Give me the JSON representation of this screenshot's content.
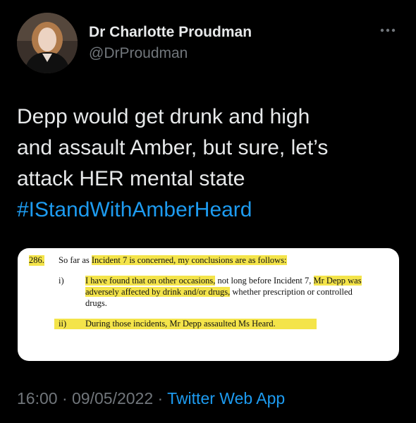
{
  "author": {
    "name": "Dr Charlotte Proudman",
    "handle": "@DrProudman"
  },
  "tweet": {
    "line1": "Depp would get drunk and high",
    "line2": "and assault Amber, but sure, let’s",
    "line3": "attack HER mental state",
    "hashtag": "#IStandWithAmberHeard"
  },
  "document": {
    "para_number": "286.",
    "intro_prefix": "So far as ",
    "intro_highlight": "Incident 7 is concerned, my conclusions are as follows:",
    "item1_label": "i)",
    "item1_l1_a": "I have found that on other occasions,",
    "item1_l1_b": " not long before Incident 7, ",
    "item1_l1_c": "Mr Depp was",
    "item1_l2_a": "adversely affected by drink and/or drugs,",
    "item1_l2_b": " whether prescription or controlled",
    "item1_l3": "drugs.",
    "item2_label": "ii)",
    "item2_text": "During those incidents, Mr Depp assaulted Ms Heard."
  },
  "footer": {
    "time": "16:00",
    "separator": " · ",
    "date": "09/05/2022",
    "separator2": " · ",
    "source": "Twitter Web App"
  },
  "icons": {
    "more": "more-horizontal-icon"
  },
  "colors": {
    "background": "#000000",
    "text": "#e7e9ea",
    "secondary": "#71767b",
    "link": "#1d9bf0",
    "highlight": "#f4e44a"
  }
}
